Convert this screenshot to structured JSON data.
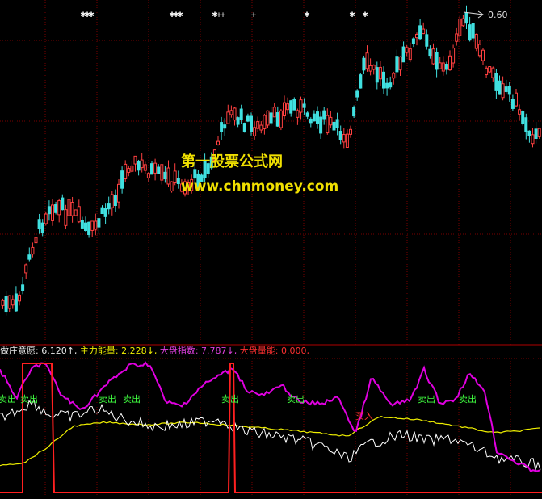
{
  "watermark": {
    "title": "第一股票公式网",
    "url": "www.chnmoney.com"
  },
  "price_label": "0.60",
  "top_marker_glyphs": {
    "star": "✱",
    "plus": "+"
  },
  "top_markers": [
    "star",
    "star",
    "star",
    "star",
    "star",
    "star",
    "star",
    "plus",
    "plus",
    "plus",
    "star",
    "star",
    "star"
  ],
  "legend": {
    "items": [
      {
        "name": "做庄意愿",
        "value": "6.120",
        "arrow": "↑",
        "color": "#e8e8e8"
      },
      {
        "name": "主力能量",
        "value": "2.228",
        "arrow": "↓",
        "color": "#f0f000"
      },
      {
        "name": "大盘指数",
        "value": "7.787",
        "arrow": "↓",
        "color": "#e040e0"
      },
      {
        "name": "大盘量能",
        "value": "0.000",
        "arrow": "",
        "color": "#ff3030"
      }
    ]
  },
  "signals": {
    "sell_label": "卖出",
    "buy_label": "买入",
    "sell_color": "#40ff40",
    "buy_color": "#ff3030",
    "sell_count": 8
  },
  "colors": {
    "grid": "#7a0000",
    "candle_up": "#ff4040",
    "candle_down": "#40e0e0",
    "white_line": "#ffffff",
    "yellow_line": "#f0f000",
    "magenta_line": "#e000e0",
    "red_line": "#ff2020"
  }
}
